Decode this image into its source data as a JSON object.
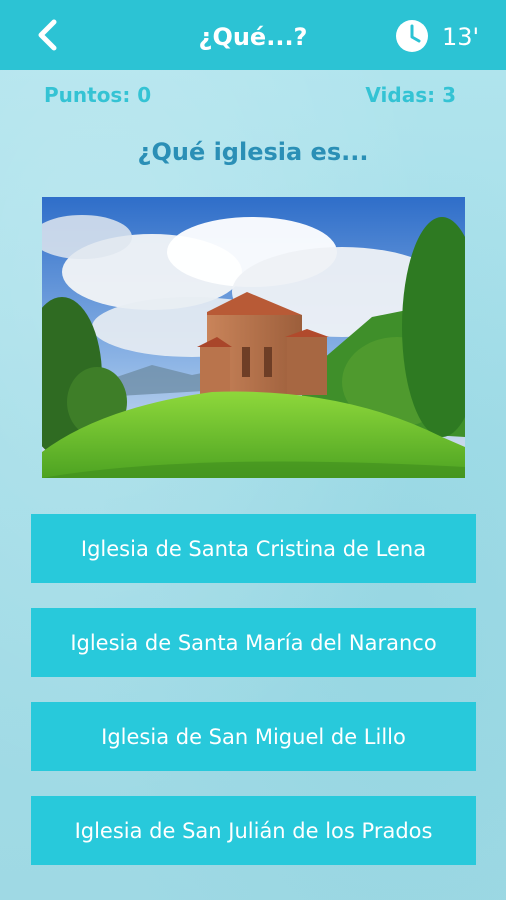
{
  "header": {
    "title": "¿Qué...?",
    "time": "13'",
    "back_icon": "chevron-left-icon",
    "clock_icon": "clock-icon"
  },
  "stats": {
    "points": "Puntos: 0",
    "lives": "Vidas: 3"
  },
  "question": "¿Qué iglesia es...",
  "answers": [
    "Iglesia de Santa Cristina de Lena",
    "Iglesia de Santa María del Naranco",
    "Iglesia de San Miguel de Lillo",
    "Iglesia de San Julián de los Prados"
  ],
  "colors": {
    "header": "#2cc3d4",
    "answer_bg": "#28c9db",
    "question_text": "#2a8fb6",
    "stat_text": "#34c3d4"
  }
}
